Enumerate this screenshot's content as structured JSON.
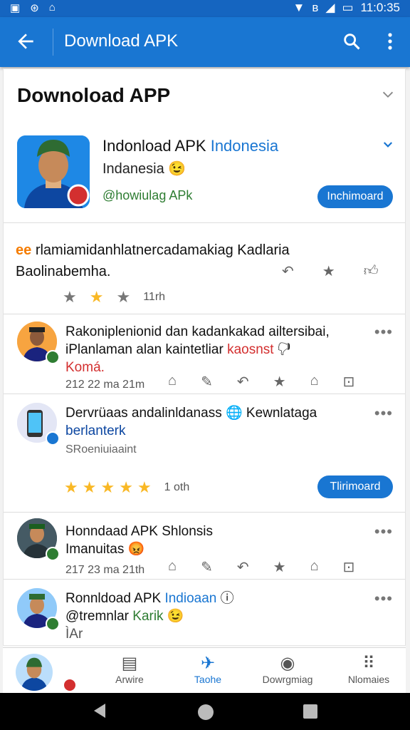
{
  "status": {
    "time": "11:0:35"
  },
  "appbar": {
    "title": "Download APK"
  },
  "section": {
    "heading": "Downoload APP"
  },
  "app": {
    "name": "Indonload APK",
    "name_accent": "Indonesia",
    "sub": "Indanesia 😉",
    "handle": "@howiulag APk",
    "button": "Inchimoard"
  },
  "description": {
    "emoji": "ee",
    "text1": "rlamiamidanhlatnercadamakiag Kadlaria",
    "text2": "Baolinabemha.",
    "rating_text": "11rh"
  },
  "posts": [
    {
      "line1": "Rakoniplenionid dan kadankakad ailtersibai,",
      "line2a": "iPlanlaman alan kaintetliar",
      "line2b": "kaosnst",
      "line3": "Komá.",
      "meta": "212  22 ma 21m"
    },
    {
      "line1": "Dervrüaas andalinldanass",
      "line1b": "Kewnlataga",
      "line2": "berlanterk",
      "line3": "SRoeniuiaaint",
      "rating_text": "1 oth",
      "button": "Tlirimoard"
    },
    {
      "line1": "Honndaad APK Shlonsis",
      "line2": "Imanuitas 😡",
      "meta": "217  23 ma 21th"
    },
    {
      "line1": "Ronnldoad APK",
      "line1b": "Indioaan",
      "line2a": "@tremnlar",
      "line2b": "Karik",
      "line3": "ÌAr"
    }
  ],
  "nav": [
    {
      "label": "Arwire"
    },
    {
      "label": "Taohe"
    },
    {
      "label": "Dowrgmiag"
    },
    {
      "label": "Nlomaies"
    }
  ],
  "colors": {
    "primary": "#1976d2",
    "statusbar": "#1565c0",
    "star": "#f9b825",
    "green": "#2e7d32",
    "red": "#d32f2f"
  }
}
